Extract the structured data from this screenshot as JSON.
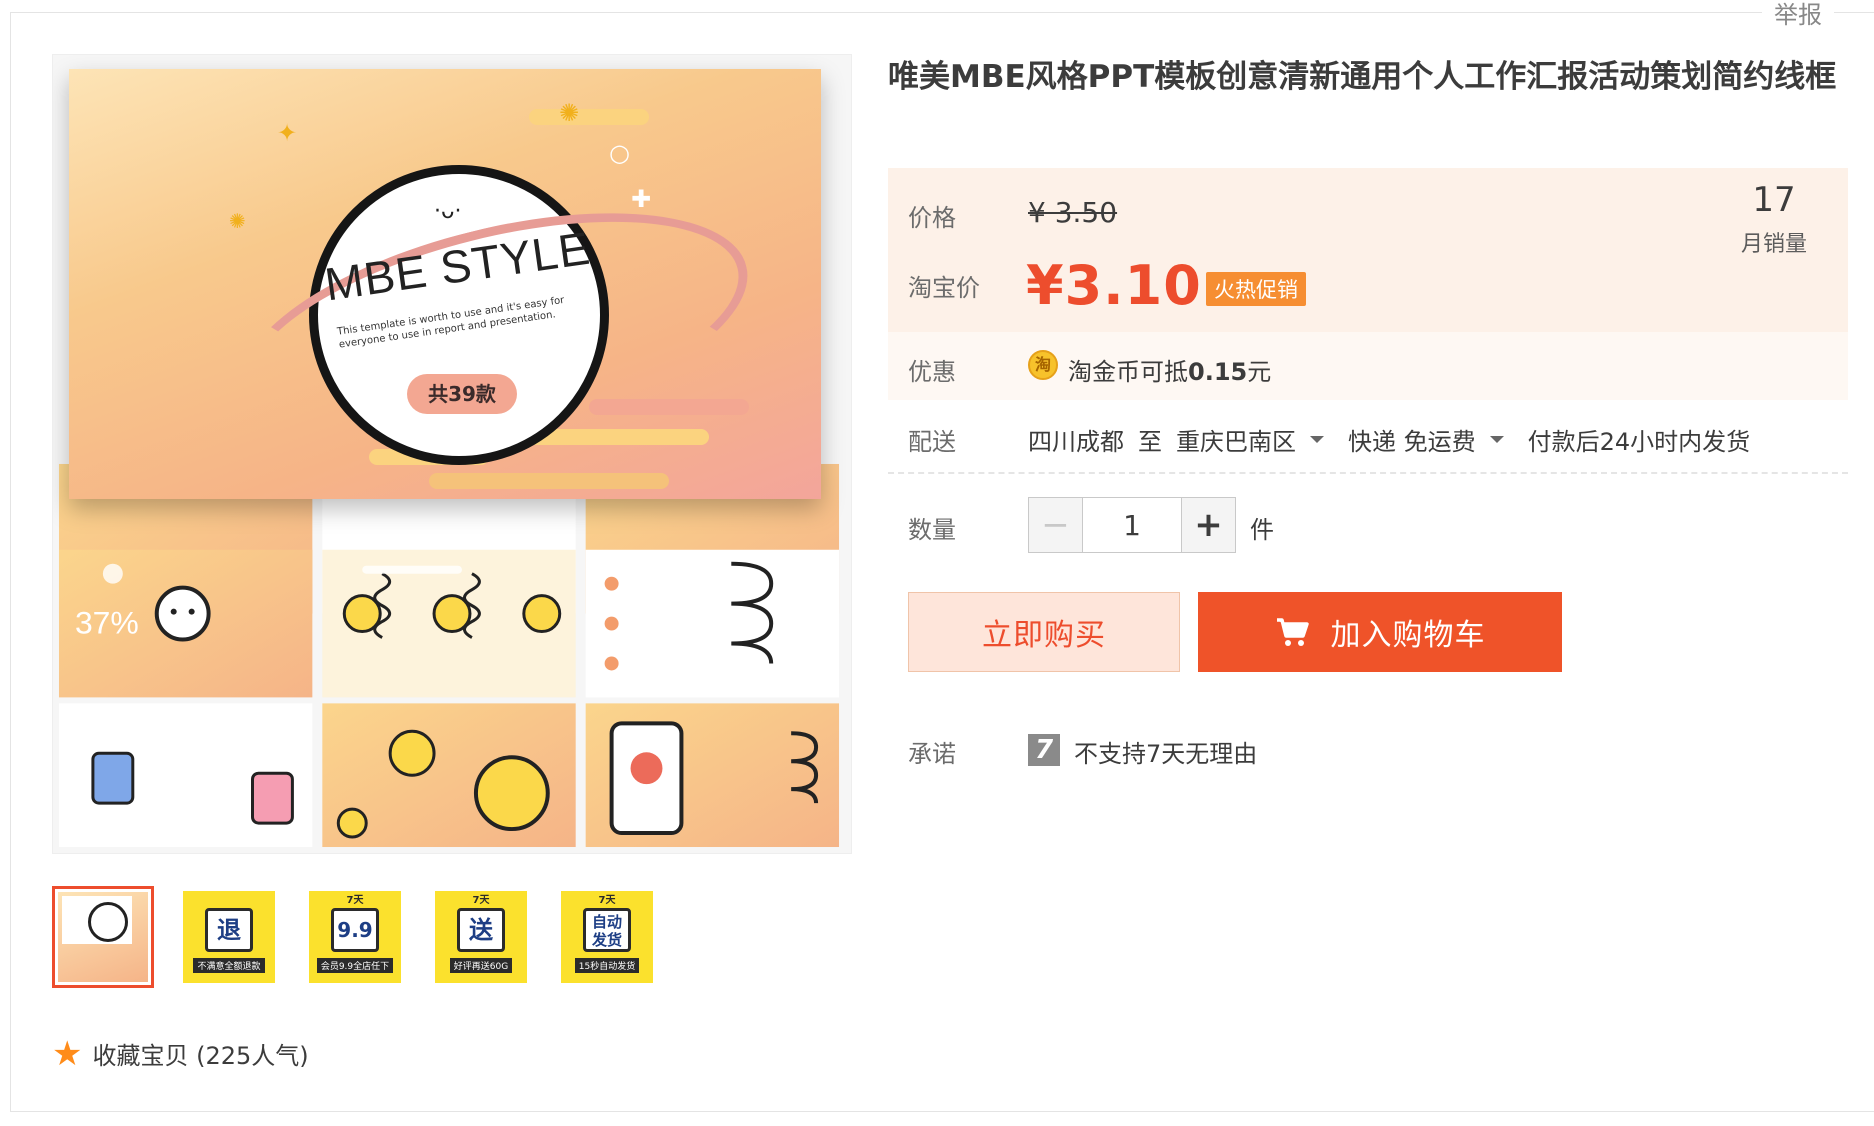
{
  "header": {
    "report_label": "举报"
  },
  "gallery": {
    "main_slide": {
      "logo_text": "MBE STYLE",
      "face": "·ᴗ·",
      "subtitle": "This template is worth to use and it's easy for everyone to use in report and presentation.",
      "count_pill": "共39款"
    },
    "thumbnails": [
      {
        "type": "preview"
      },
      {
        "top": "",
        "char": "退",
        "tag": "不满意全额退款"
      },
      {
        "top": "7天",
        "char": "9.9",
        "tag": "会员9.9全店任下"
      },
      {
        "top": "7天",
        "char": "送",
        "tag": "好评再送60G"
      },
      {
        "top": "7天",
        "char": "自动发货",
        "tag": "15秒自动发货"
      }
    ],
    "favorite": {
      "label": "收藏宝贝 (225人气)"
    }
  },
  "product": {
    "title": "唯美MBE风格PPT模板创意清新通用个人工作汇报活动策划简约线框",
    "price": {
      "label": "价格",
      "original": "¥ 3.50",
      "taobao_label": "淘宝价",
      "sale": "¥3.10",
      "tag": "火热促销"
    },
    "sales": {
      "count": "17",
      "label": "月销量"
    },
    "promo": {
      "label": "优惠",
      "coin_icon": "淘",
      "text_prefix": "淘金币可抵",
      "amount": "0.15",
      "text_suffix": "元"
    },
    "shipping": {
      "label": "配送",
      "from": "四川成都",
      "sep": "至",
      "to": "重庆巴南区",
      "method": "快递 免运费",
      "note": "付款后24小时内发货"
    },
    "quantity": {
      "label": "数量",
      "value": "1",
      "unit": "件",
      "minus": "−",
      "plus": "+"
    },
    "actions": {
      "buy_now": "立即购买",
      "add_cart": "加入购物车"
    },
    "promise": {
      "label": "承诺",
      "icon": "7",
      "text": "不支持7天无理由"
    }
  },
  "colors": {
    "accent": "#ed4d2d",
    "price_bg": "#fdf1e8",
    "hot_tag": "#f68e32",
    "add_cart": "#ef5329",
    "buy_now_bg": "#fee5da"
  }
}
